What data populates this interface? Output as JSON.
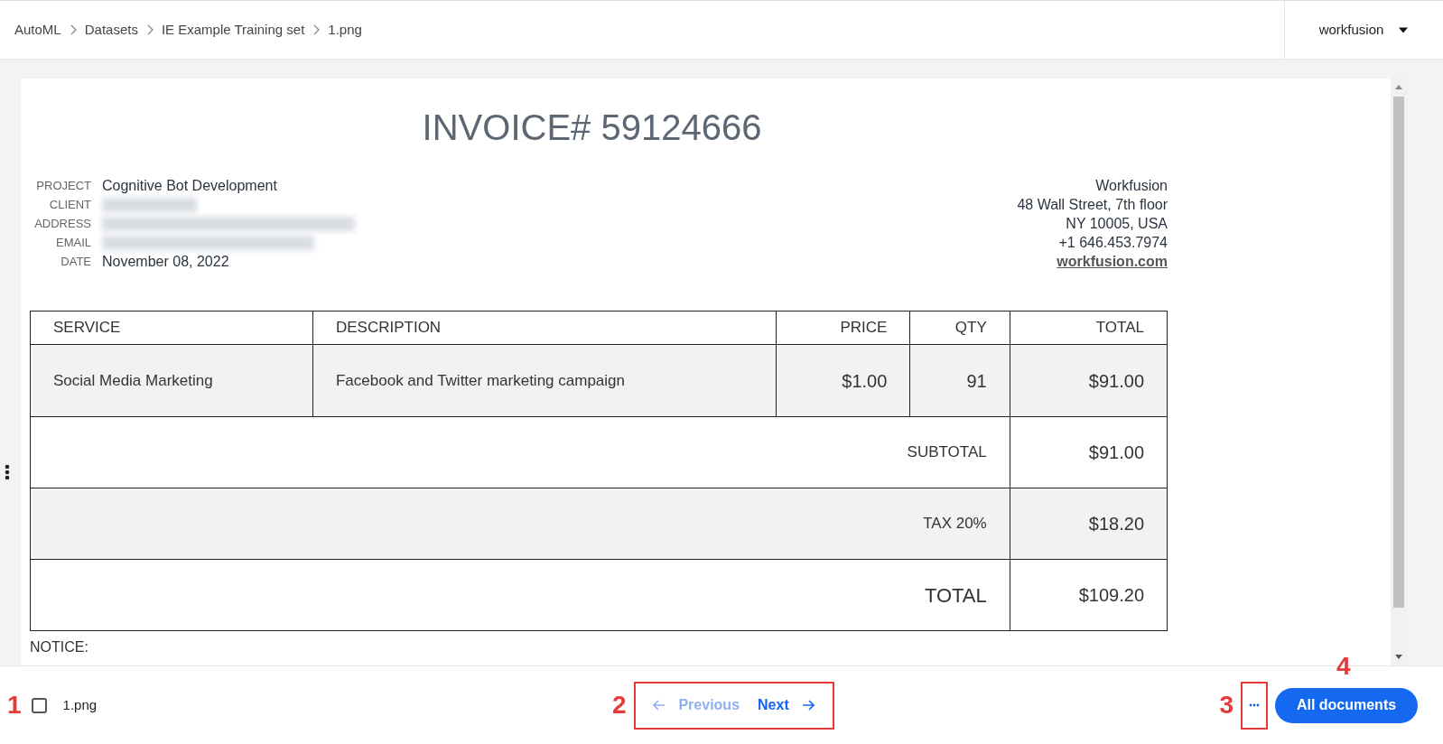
{
  "breadcrumb": [
    {
      "label": "AutoML"
    },
    {
      "label": "Datasets"
    },
    {
      "label": "IE Example Training set"
    },
    {
      "label": "1.png"
    }
  ],
  "user_menu": {
    "label": "workfusion"
  },
  "document": {
    "title": "INVOICE# 59124666",
    "fields": [
      {
        "label": "PROJECT",
        "value": "Cognitive Bot Development",
        "redacted": false
      },
      {
        "label": "CLIENT",
        "redacted": true
      },
      {
        "label": "ADDRESS",
        "redacted": true
      },
      {
        "label": "EMAIL",
        "redacted": true
      },
      {
        "label": "DATE",
        "value": "November 08, 2022",
        "redacted": false
      }
    ],
    "company": {
      "lines": [
        "Workfusion",
        "48 Wall Street, 7th floor",
        "NY 10005, USA",
        "+1 646.453.7974"
      ],
      "link": "workfusion.com"
    },
    "table": {
      "columns": [
        "SERVICE",
        "DESCRIPTION",
        "PRICE",
        "QTY",
        "TOTAL"
      ],
      "rows": [
        {
          "cells": [
            "Social Media Marketing",
            "Facebook and Twitter marketing campaign",
            "$1.00",
            "91",
            "$91.00"
          ],
          "shaded": true
        }
      ],
      "summary": [
        {
          "label": "SUBTOTAL",
          "value": "$91.00",
          "shaded": false,
          "emphasis": false
        },
        {
          "label": "TAX 20%",
          "value": "$18.20",
          "shaded": true,
          "emphasis": false
        },
        {
          "label": "TOTAL",
          "value": "$109.20",
          "shaded": false,
          "emphasis": true
        }
      ]
    },
    "notice": "NOTICE:"
  },
  "footer": {
    "file": {
      "name": "1.png",
      "checked": false
    },
    "previous": {
      "label": "Previous",
      "disabled": true
    },
    "next": {
      "label": "Next",
      "disabled": false
    },
    "all_documents": {
      "label": "All documents"
    }
  },
  "annotations": [
    {
      "number": "1"
    },
    {
      "number": "2"
    },
    {
      "number": "3"
    },
    {
      "number": "4"
    }
  ]
}
